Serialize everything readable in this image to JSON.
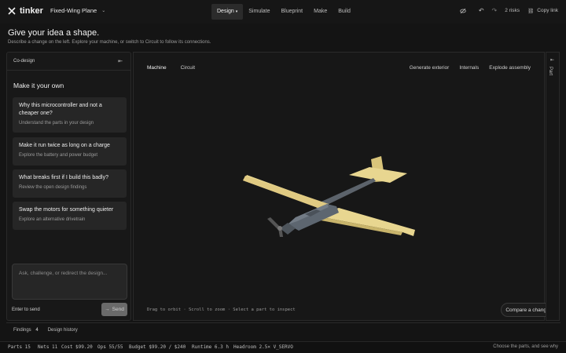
{
  "app": {
    "name": "tinker"
  },
  "project": {
    "name": "Fixed-Wing Plane"
  },
  "nav": {
    "tabs": [
      "Design",
      "Simulate",
      "Blueprint",
      "Make",
      "Build"
    ],
    "active": "Design"
  },
  "topright": {
    "risks": "2 risks",
    "copy_link": "Copy link"
  },
  "heading": {
    "title": "Give your idea a shape.",
    "subtitle": "Describe a change on the left. Explore your machine, or switch to Circuit to follow its connections."
  },
  "codesign": {
    "header": "Co-design",
    "title": "Make it your own",
    "cards": [
      {
        "title": "Why this microcontroller and not a cheaper one?",
        "subtitle": "Understand the parts in your design"
      },
      {
        "title": "Make it run twice as long on a charge",
        "subtitle": "Explore the battery and power budget"
      },
      {
        "title": "What breaks first if I build this badly?",
        "subtitle": "Review the open design findings"
      },
      {
        "title": "Swap the motors for something quieter",
        "subtitle": "Explore an alternative drivetrain"
      }
    ],
    "input_placeholder": "Ask, challenge, or redirect the design...",
    "enter_hint": "Enter to send",
    "send_label": "Send"
  },
  "bottom_tabs": {
    "findings": "Findings",
    "findings_count": "4",
    "history": "Design history"
  },
  "viewer": {
    "tabs": [
      "Machine",
      "Circuit"
    ],
    "active_tab": "Machine",
    "actions": [
      "Generate exterior",
      "Internals",
      "Explode assembly"
    ],
    "hint": "Drag to orbit · Scroll to zoom · Select a part to inspect",
    "compare": "Compare a change"
  },
  "right_rail": {
    "label": "Part"
  },
  "status": {
    "parts": "Parts 15",
    "nets": "Nets 11",
    "cost": "Cost $99.20",
    "ops": "Ops 55/55",
    "budget": "Budget $99.20 / $240",
    "runtime": "Runtime 6.3 h",
    "headroom": "Headroom 2.5× V_SERVO",
    "right": "Choose the parts, and see why"
  },
  "colors": {
    "wing": "#e8d690",
    "fuselage": "#5d6670",
    "background": "#141414"
  }
}
